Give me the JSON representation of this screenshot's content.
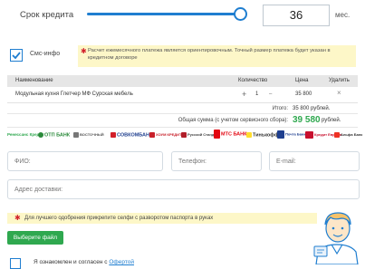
{
  "credit": {
    "term_label": "Срок кредита",
    "term_value": "36",
    "term_unit": "мес."
  },
  "sms": {
    "label": "Смс-инфо",
    "checked": true
  },
  "notice_payment": {
    "text": "Расчет ежемесячного платежа является ориентировочным. Точный размер платежа будет указан в кредитном договоре"
  },
  "cart": {
    "columns": {
      "name": "Наименование",
      "qty": "Количество",
      "price": "Цена",
      "delete": "Удалить"
    },
    "rows": [
      {
        "name": "Модульная кухня Глетчер МФ Сурская мебель",
        "qty_minus": "+",
        "qty": "1",
        "qty_plus": "–",
        "price": "35 800",
        "delete": "×"
      }
    ],
    "total_label": "Итого:",
    "total_value": "35 800 рублей.",
    "sum_label": "Общая сумма (с учетом сервисного сбора):",
    "sum_value": "39 580",
    "sum_currency": "рублей."
  },
  "banks": [
    {
      "name": "Ренессанс Кредит",
      "color": "#2fa84f"
    },
    {
      "name": "ОТП БАНК",
      "color": "#2a8a3a"
    },
    {
      "name": "ВОСТОЧНЫЙ",
      "color": "#555555"
    },
    {
      "name": "СОВКОМБАНК",
      "color": "#d2202a"
    },
    {
      "name": "ХОУМ КРЕДИТ",
      "color": "#c8202a"
    },
    {
      "name": "Русский Стандарт",
      "color": "#b01e2a"
    },
    {
      "name": "МТС БАНК",
      "color": "#e30611"
    },
    {
      "name": "Тинькофф",
      "color": "#333333"
    },
    {
      "name": "Почта Банк",
      "color": "#1f3f8f"
    },
    {
      "name": "Кредит Европа",
      "color": "#c8102e"
    },
    {
      "name": "Альфа Банк",
      "color": "#ef3124"
    }
  ],
  "form": {
    "fio_placeholder": "ФИО:",
    "phone_placeholder": "Телефон:",
    "email_placeholder": "E-mail:",
    "address_placeholder": "Адрес доставки:"
  },
  "notice_passport": {
    "text": "Для лучшего одобрения прикрепите селфи с разворотом паспорта в руках"
  },
  "upload_button": "Выберите файл",
  "agreement": {
    "text": "Я ознакомлен и согласен с ",
    "link": "Офертой"
  },
  "colors": {
    "accent": "#1f7ed0",
    "success": "#2fa84f",
    "notice_bg": "#fdf7c8",
    "alert": "#d2202a"
  },
  "icons": [
    "checkmark-icon",
    "asterisk-icon",
    "plus-icon",
    "minus-icon",
    "delete-icon",
    "mascot-icon"
  ]
}
